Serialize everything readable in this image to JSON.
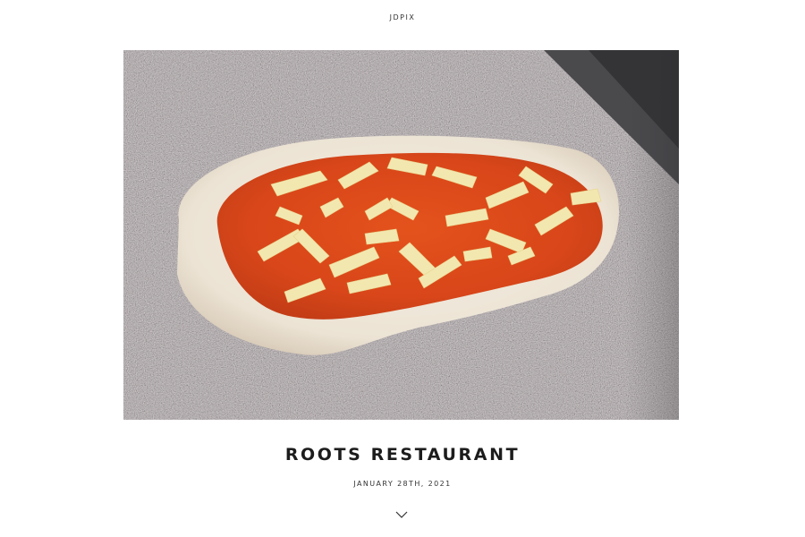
{
  "site": {
    "logo_text": "JDPIX"
  },
  "hero": {
    "image_icon": "pizza-photo"
  },
  "post": {
    "title": "ROOTS RESTAURANT",
    "date": "JANUARY 28TH, 2021"
  },
  "scroll": {
    "icon": "chevron-down-icon"
  }
}
